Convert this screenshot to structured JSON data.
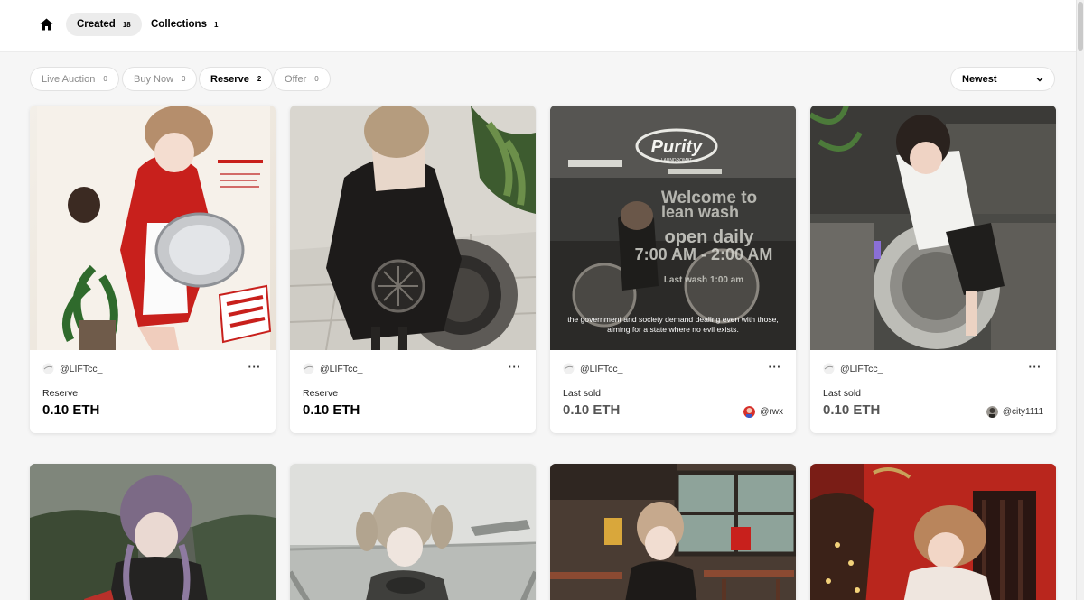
{
  "nav": {
    "home_icon": "home-icon",
    "tabs": [
      {
        "label": "Created",
        "count": "18",
        "active": true
      },
      {
        "label": "Collections",
        "count": "1",
        "active": false
      }
    ]
  },
  "filters": [
    {
      "label": "Live Auction",
      "count": "0",
      "active": false
    },
    {
      "label": "Buy Now",
      "count": "0",
      "active": false
    },
    {
      "label": "Reserve",
      "count": "2",
      "active": true
    },
    {
      "label": "Offer",
      "count": "0",
      "active": false
    }
  ],
  "sort": {
    "label": "Newest",
    "icon": "chevron-down-icon"
  },
  "cards": [
    {
      "creator": "@LIFTcc_",
      "price_label": "Reserve",
      "price": "0.10 ETH",
      "buyer": null
    },
    {
      "creator": "@LIFTcc_",
      "price_label": "Reserve",
      "price": "0.10 ETH",
      "buyer": null
    },
    {
      "creator": "@LIFTcc_",
      "price_label": "Last sold",
      "price": "0.10 ETH",
      "buyer": "@rwx",
      "art_text": {
        "sign_title": "Purity",
        "sign_sub": "LAUNDROMAT",
        "window_line1": "Welcome to",
        "window_line2": "lean wash",
        "window_line3": "open daily",
        "window_line4": "7:00 AM - 2:00 AM",
        "window_line5": "Last wash 1:00 am",
        "caption1": "the government and society demand dealing even with those,",
        "caption2": "aiming for a state where no evil exists."
      }
    },
    {
      "creator": "@LIFTcc_",
      "price_label": "Last sold",
      "price": "0.10 ETH",
      "buyer": "@city1111"
    }
  ],
  "more_icon": "more-dots-icon",
  "colors": {
    "accent_red": "#c8201c",
    "border": "#e2e2e2",
    "active_tab_bg": "#ececec"
  }
}
